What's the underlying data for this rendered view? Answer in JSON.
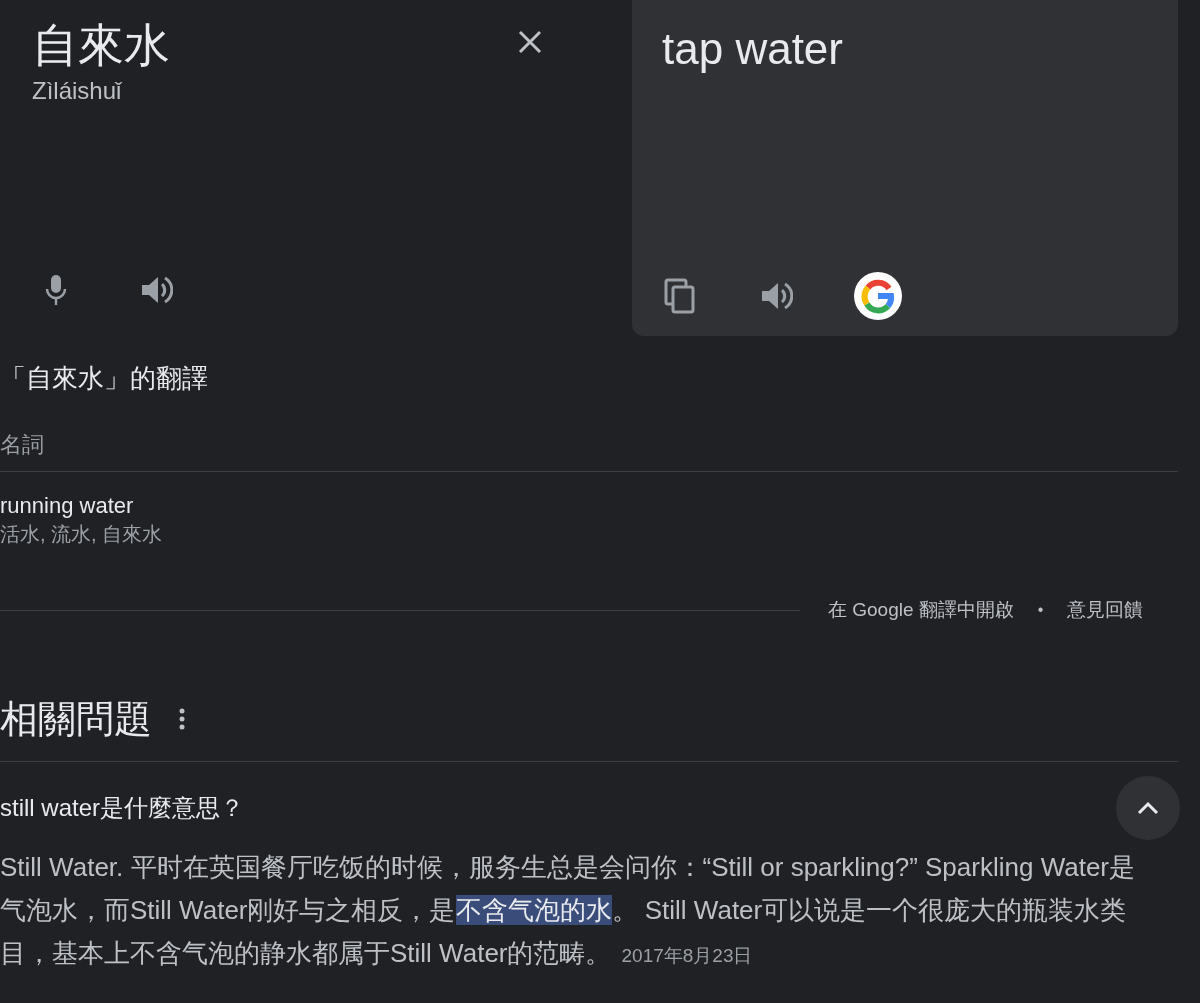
{
  "source": {
    "text": "自來水",
    "romanization": "Zìláishuǐ"
  },
  "target": {
    "text": "tap water"
  },
  "dictionary": {
    "title": "「自來水」的翻譯",
    "part_of_speech": "名詞",
    "entries": [
      {
        "term": "running water",
        "synonyms": "活水, 流水, 自來水"
      }
    ]
  },
  "footer_links": [
    "在 Google 翻譯中開啟",
    "•",
    "意見回饋"
  ],
  "related": {
    "title": "相關問題",
    "questions": [
      {
        "question": "still water是什麼意思？",
        "expanded": true,
        "answer": [
          {
            "text": "Still Water. 平时在英国餐厅吃饭的时候，服务生总是会问你：“Still or sparkling?” Sparkling Water是气泡水，而Still Water刚好与之相反，是",
            "highlighted": false
          },
          {
            "text": "不含气泡的水",
            "highlighted": true
          },
          {
            "text": "。 Still Water可以说是一个很庞大的瓶装水类目，基本上不含气泡的静水都属于Still Water的范畴。",
            "highlighted": false
          }
        ],
        "date": "2017年8月23日"
      }
    ]
  }
}
